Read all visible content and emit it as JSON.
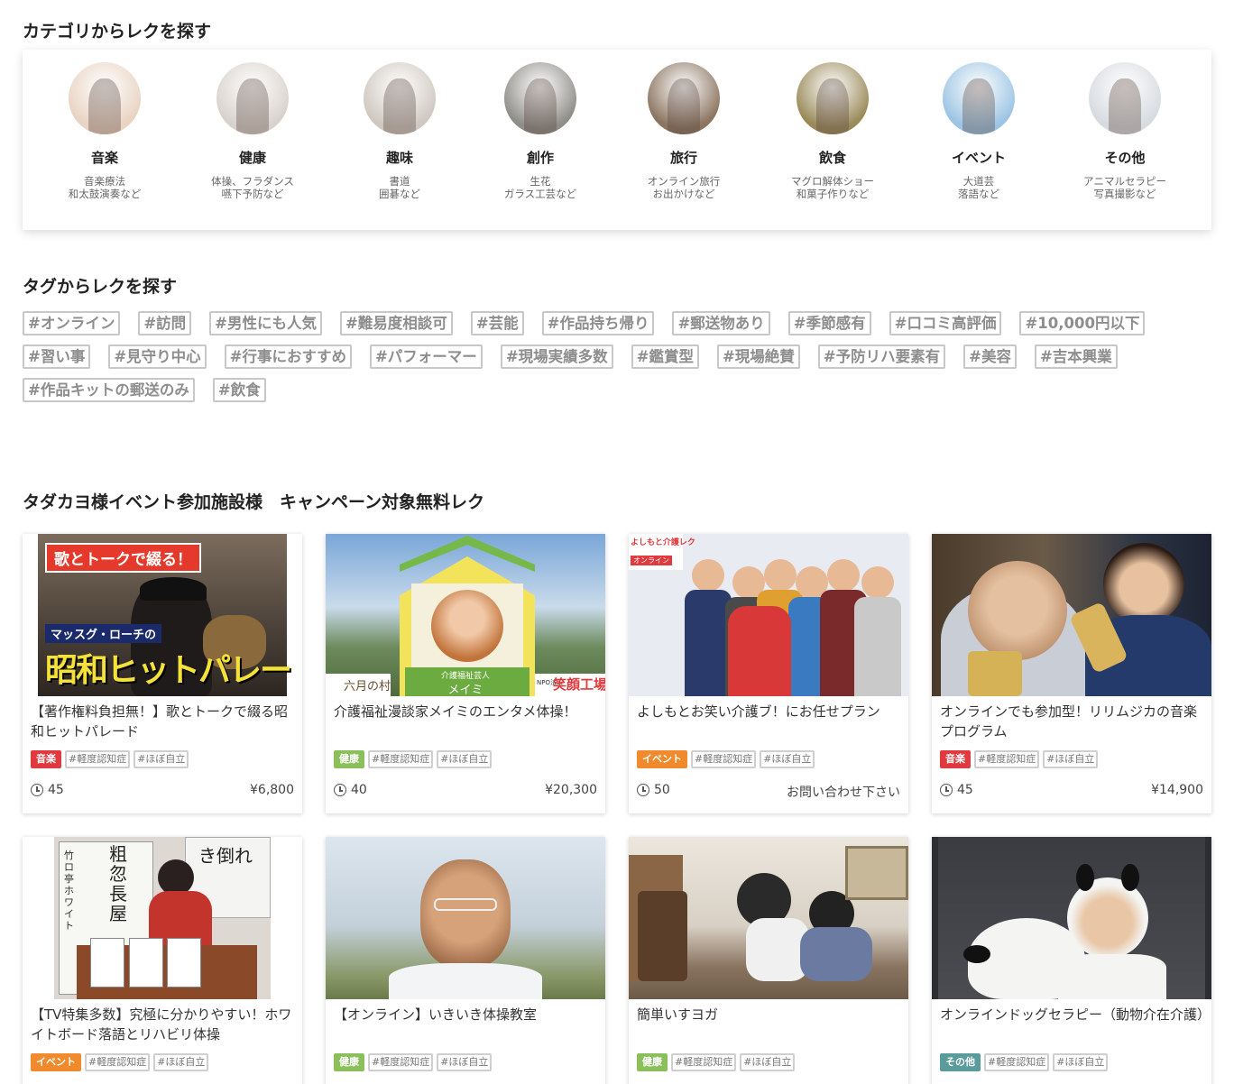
{
  "categories_section": {
    "title": "カテゴリからレクを探す",
    "items": [
      {
        "name": "音楽",
        "desc": "音楽療法\n和太鼓演奏など",
        "icon": "violin-photo",
        "color": "#e9d3c2"
      },
      {
        "name": "健康",
        "desc": "体操、フラダンス\n嚥下予防など",
        "icon": "exercise-photo",
        "color": "#d8d2cc"
      },
      {
        "name": "趣味",
        "desc": "書道\n囲碁など",
        "icon": "calligraphy-photo",
        "color": "#cfc8c0"
      },
      {
        "name": "創作",
        "desc": "生花\nガラス工芸など",
        "icon": "craft-photo",
        "color": "#8f8d88"
      },
      {
        "name": "旅行",
        "desc": "オンライン旅行\nお出かけなど",
        "icon": "street-photo",
        "color": "#8b7460"
      },
      {
        "name": "飲食",
        "desc": "マグロ解体ショー\n和菓子作りなど",
        "icon": "food-photo",
        "color": "#9a8a5a"
      },
      {
        "name": "イベント",
        "desc": "大道芸\n落語など",
        "icon": "party-photo",
        "color": "#9cc4e4"
      },
      {
        "name": "その他",
        "desc": "アニマルセラピー\n写真撮影など",
        "icon": "seniors-photo",
        "color": "#d7dbe0"
      }
    ]
  },
  "tags_section": {
    "title": "タグからレクを探す",
    "rows": [
      [
        "#オンライン",
        "#訪問",
        "#男性にも人気",
        "#難易度相談可",
        "#芸能",
        "#作品持ち帰り",
        "#郵送物あり",
        "#季節感有",
        "#口コミ高評価",
        "#10,000円以下"
      ],
      [
        "#習い事",
        "#見守り中心",
        "#行事におすすめ",
        "#パフォーマー",
        "#現場実績多数",
        "#鑑賞型",
        "#現場絶賛",
        "#予防リハ要素有",
        "#美容",
        "#吉本興業"
      ],
      [
        "#作品キットの郵送のみ",
        "#飲食"
      ]
    ]
  },
  "campaign_section": {
    "title": "タダカヨ様イベント参加施設様　キャンペーン対象無料レク",
    "cards": [
      {
        "title": "【著作権料負担無！】歌とトークで綴る昭和ヒットパレード",
        "category": "音楽",
        "badge_color": "#e0393e",
        "tags": [
          "#軽度認知症",
          "#ほぼ自立"
        ],
        "duration": "45",
        "price": "¥6,800",
        "image": {
          "icon": "singer-photo",
          "top_text": "歌とトークで綴る！",
          "mid_text": "マッスグ・ローチの",
          "big_text": "昭和ヒットパレード"
        }
      },
      {
        "title": "介護福祉漫談家メイミのエンタメ体操！",
        "category": "健康",
        "badge_color": "#8bbf5a",
        "tags": [
          "#軽度認知症",
          "#ほぼ自立"
        ],
        "duration": "40",
        "price": "¥20,300",
        "image": {
          "icon": "comedian-photo",
          "label_small": "介護福祉芸人",
          "label_name": "メイミ",
          "left_logo": "六月の村",
          "right_logo": "笑顔工場",
          "right_logo_prefix": "NPO法人"
        }
      },
      {
        "title": "よしもとお笑い介護ブ！にお任せプラン",
        "category": "イベント",
        "badge_color": "#f08a2c",
        "tags": [
          "#軽度認知症",
          "#ほぼ自立"
        ],
        "duration": "50",
        "price": "お問い合わせ下さい",
        "image": {
          "icon": "comedians-group-photo",
          "corner_text": "よしもと介護レク",
          "corner_sub": "オンライン"
        }
      },
      {
        "title": "オンラインでも参加型！リリムジカの音楽プログラム",
        "category": "音楽",
        "badge_color": "#e0393e",
        "tags": [
          "#軽度認知症",
          "#ほぼ自立"
        ],
        "duration": "45",
        "price": "¥14,900",
        "image": {
          "icon": "music-therapy-photo"
        }
      },
      {
        "title": "【TV特集多数】究極に分かりやすい！ホワイトボード落語とリハビリ体操",
        "category": "イベント",
        "badge_color": "#f08a2c",
        "tags": [
          "#軽度認知症",
          "#ほぼ自立"
        ],
        "duration": "",
        "price": "",
        "image": {
          "icon": "rakugo-photo",
          "board_title": "粗忽長屋",
          "board_sub": "竹ロ亭 ホワイト",
          "board_right": "き倒れ"
        }
      },
      {
        "title": "【オンライン】いきいき体操教室",
        "category": "健康",
        "badge_color": "#8bbf5a",
        "tags": [
          "#軽度認知症",
          "#ほぼ自立"
        ],
        "duration": "",
        "price": "",
        "image": {
          "icon": "instructor-photo"
        }
      },
      {
        "title": "簡単いすヨガ",
        "category": "健康",
        "badge_color": "#8bbf5a",
        "tags": [
          "#軽度認知症",
          "#ほぼ自立"
        ],
        "duration": "",
        "price": "",
        "image": {
          "icon": "chair-yoga-photo"
        }
      },
      {
        "title": "オンラインドッグセラピー（動物介在介護）",
        "category": "その他",
        "badge_color": "#5a9c9b",
        "tags": [
          "#軽度認知症",
          "#ほぼ自立"
        ],
        "duration": "",
        "price": "",
        "image": {
          "icon": "dog-therapy-photo"
        }
      }
    ]
  }
}
